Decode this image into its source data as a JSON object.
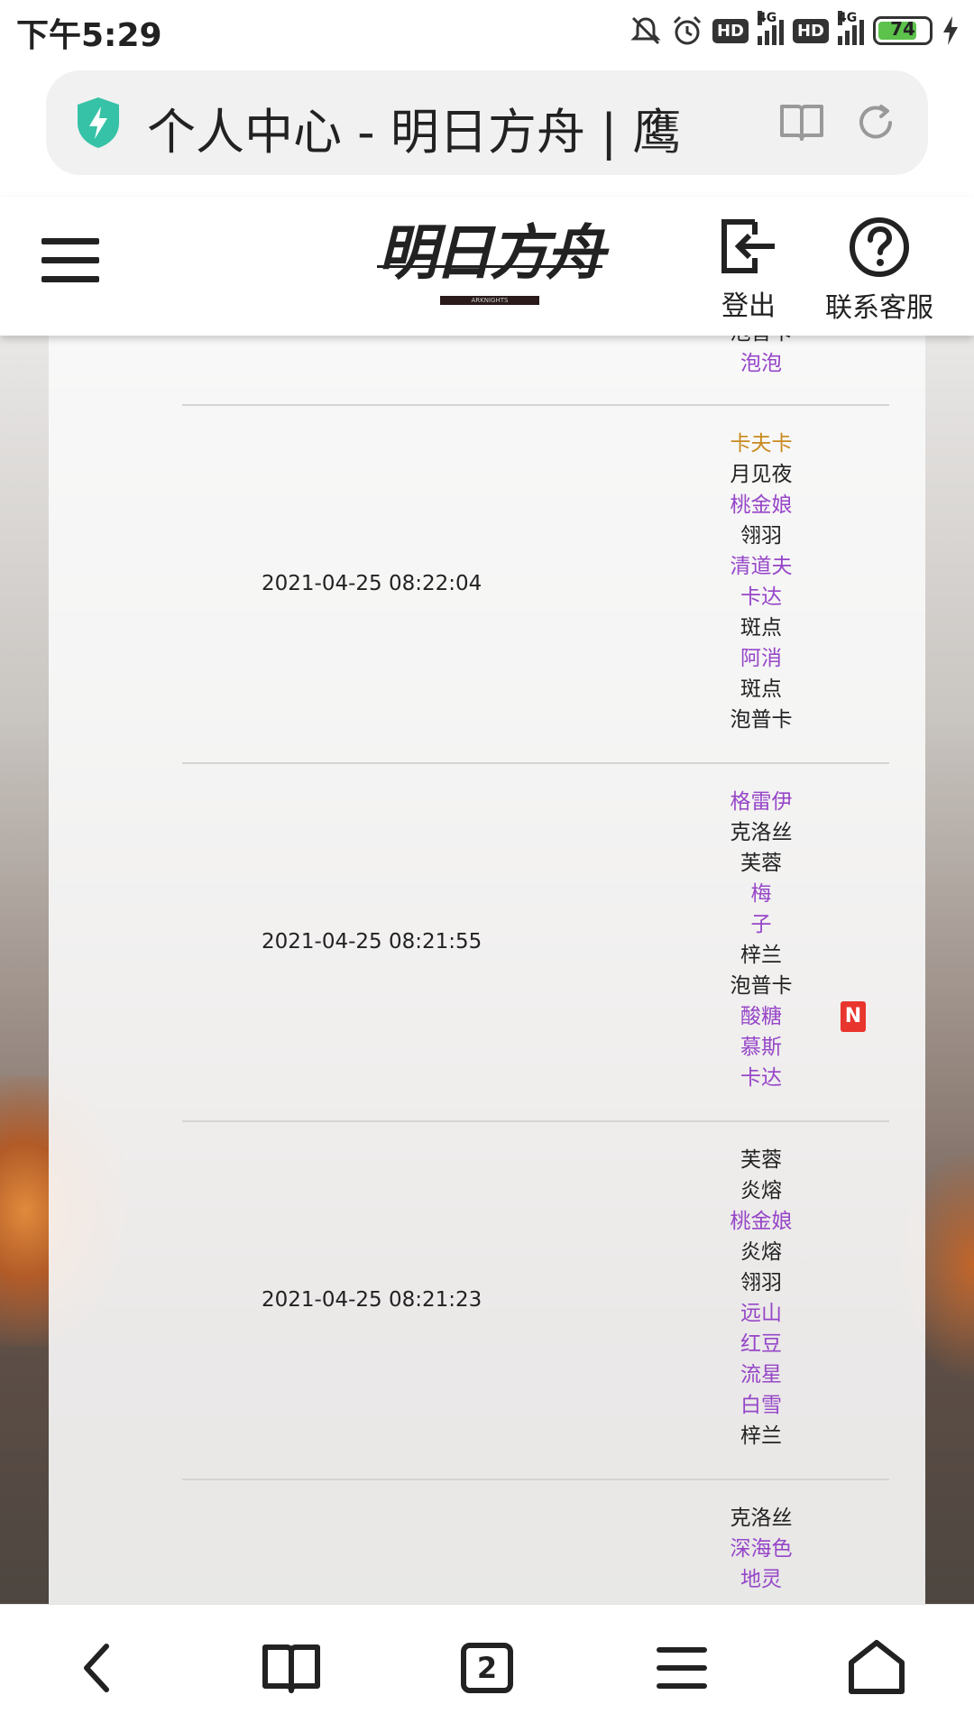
{
  "status_bar": {
    "time": "下午5:29",
    "hd1": "HD",
    "hd2": "HD",
    "net1": "4G",
    "net2": "4G",
    "battery": "74",
    "icons": [
      "mute-icon",
      "alarm-icon",
      "signal-icon",
      "battery-icon",
      "charging-icon"
    ]
  },
  "browser": {
    "page_title": "个人中心 - 明日方舟 | 鹰",
    "icons": [
      "shield-icon",
      "reader-mode-icon",
      "reload-icon"
    ]
  },
  "site_header": {
    "logo_text": "明日方舟",
    "logo_sub": "ARKNIGHTS",
    "logout_label": "登出",
    "help_label": "联系客服"
  },
  "records": {
    "partial_top": {
      "names": [
        "泡普卡",
        "泡泡"
      ]
    },
    "rows": [
      {
        "time": "2021-04-25 08:22:04",
        "names": [
          "卡夫卡",
          "月见夜",
          "桃金娘",
          "翎羽",
          "清道夫",
          "卡达",
          "斑点",
          "阿消",
          "斑点",
          "泡普卡"
        ],
        "colors": [
          "gold",
          "black",
          "purple",
          "black",
          "purple",
          "purple",
          "black",
          "purple",
          "black",
          "black"
        ]
      },
      {
        "time": "2021-04-25 08:21:55",
        "names": [
          "格雷伊",
          "克洛丝",
          "芙蓉",
          "梅",
          "子",
          "梓兰",
          "泡普卡",
          "酸糖",
          "慕斯",
          "卡达"
        ],
        "colors": [
          "purple",
          "black",
          "black",
          "purple",
          "purple",
          "black",
          "black",
          "purple",
          "purple",
          "purple"
        ],
        "new_badge": "N"
      },
      {
        "time": "2021-04-25 08:21:23",
        "names": [
          "芙蓉",
          "炎熔",
          "桃金娘",
          "炎熔",
          "翎羽",
          "远山",
          "红豆",
          "流星",
          "白雪",
          "梓兰"
        ],
        "colors": [
          "black",
          "black",
          "purple",
          "black",
          "black",
          "purple",
          "purple",
          "purple",
          "purple",
          "black"
        ]
      },
      {
        "time": "",
        "names": [
          "克洛丝",
          "深海色",
          "地灵"
        ],
        "colors": [
          "black",
          "purple",
          "purple"
        ]
      }
    ],
    "rarity_colors": {
      "gold": "#c98a1f",
      "purple": "#9646c8",
      "black": "#222222"
    }
  },
  "bottom_nav": {
    "tab_count": "2",
    "icons": [
      "back-icon",
      "bookmarks-icon",
      "tabs-icon",
      "menu-icon",
      "home-icon"
    ]
  }
}
